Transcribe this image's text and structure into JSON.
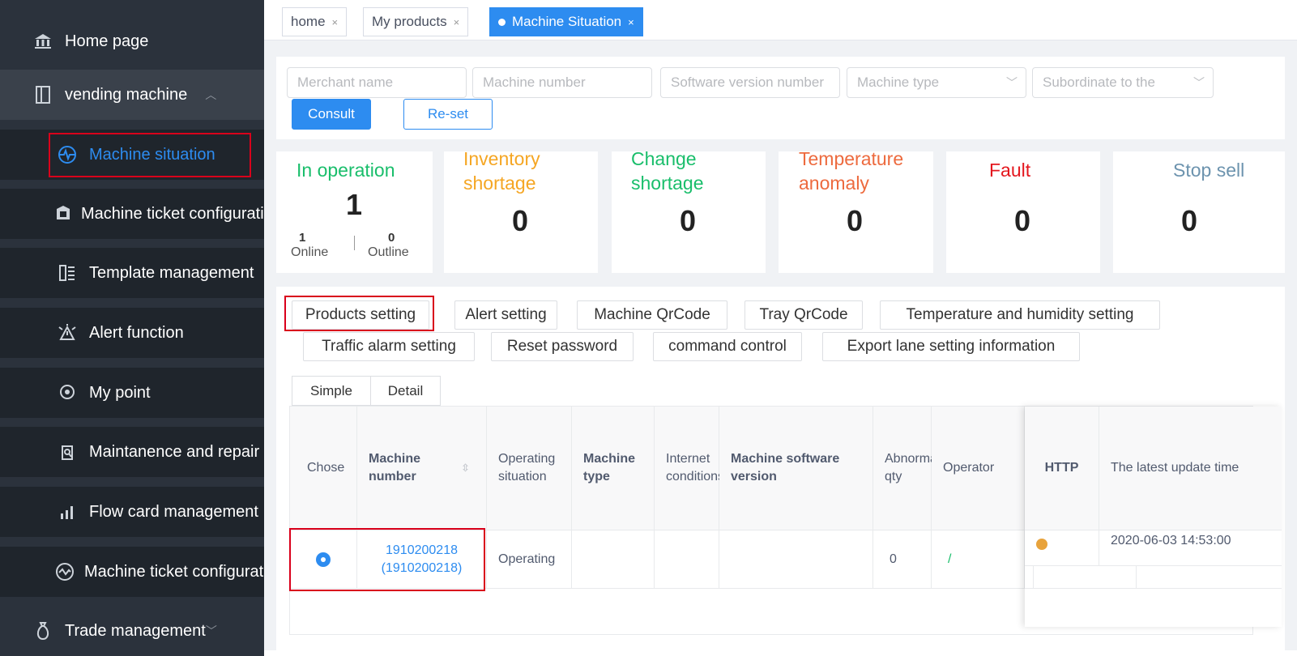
{
  "sidebar": {
    "home": {
      "label": "Home page",
      "icon": "bank-icon"
    },
    "vending": {
      "label": "vending machine",
      "icon": "book-icon"
    },
    "items": [
      {
        "label": "Machine situation",
        "icon": "pulse-icon",
        "active": true
      },
      {
        "label": "Machine ticket configuration",
        "icon": "ticket-icon"
      },
      {
        "label": "Template management",
        "icon": "template-icon"
      },
      {
        "label": "Alert function",
        "icon": "alert-icon"
      },
      {
        "label": "My point",
        "icon": "location-icon"
      },
      {
        "label": "Maintanence and repair",
        "icon": "repair-icon"
      },
      {
        "label": "Flow card management",
        "icon": "signal-icon"
      },
      {
        "label": "Machine ticket configuration",
        "icon": "wave-icon"
      }
    ],
    "trade": {
      "label": "Trade management",
      "icon": "moneybag-icon"
    }
  },
  "tabs": [
    {
      "label": "home",
      "close": "×"
    },
    {
      "label": "My products",
      "close": "×"
    },
    {
      "label": "Machine Situation",
      "close": "×",
      "active": true
    }
  ],
  "filters": {
    "merchant_name": "Merchant name",
    "machine_number": "Machine number",
    "software_version": "Software version number",
    "machine_type": "Machine type",
    "subordinate": "Subordinate to the",
    "consult_label": "Consult",
    "reset_label": "Re-set"
  },
  "status_cards": {
    "operation": {
      "label": "In operation",
      "value": "1",
      "online_value": "1",
      "online_label": "Online",
      "outline_value": "0",
      "outline_label": "Outline",
      "color": "#19be6b"
    },
    "inventory": {
      "label": "Inventory shortage",
      "value": "0",
      "color": "#f5a623"
    },
    "change": {
      "label": "Change shortage",
      "value": "0",
      "color": "#19be6b"
    },
    "temperature": {
      "label": "Temperature anomaly",
      "value": "0",
      "color": "#ed6a3e"
    },
    "fault": {
      "label": "Fault",
      "value": "0",
      "color": "#e4171e"
    },
    "stop": {
      "label": "Stop sell",
      "value": "0",
      "color": "#6c93ae"
    }
  },
  "actions": {
    "products_setting": "Products setting",
    "alert_setting": "Alert setting",
    "machine_qrcode": "Machine QrCode",
    "tray_qrcode": "Tray QrCode",
    "temp_humidity": "Temperature and humidity setting",
    "traffic_alarm": "Traffic alarm setting",
    "reset_password": "Reset password",
    "command_control": "command control",
    "export_lane": "Export lane setting information"
  },
  "view_toggle": {
    "simple": "Simple",
    "detail": "Detail"
  },
  "table": {
    "headers": {
      "choose": "Chose",
      "machine_number": "Machine number",
      "operating_situation": "Operating situation",
      "machine_type": "Machine type",
      "internet": "Internet conditions",
      "software": "Machine software version",
      "abnormal_qty": "Abnormal qty",
      "operator": "Operator",
      "http": "HTTP",
      "latest_update": "The latest update time"
    },
    "rows": [
      {
        "machine_number": "1910200218",
        "machine_number_sub": "(1910200218)",
        "operating_situation": "Operating",
        "machine_type": "",
        "internet": "",
        "software": "",
        "abnormal_qty": "0",
        "operator": "/",
        "http_status_color": "#e8a33c",
        "latest_update": "2020-06-03 14:53:00"
      }
    ]
  }
}
